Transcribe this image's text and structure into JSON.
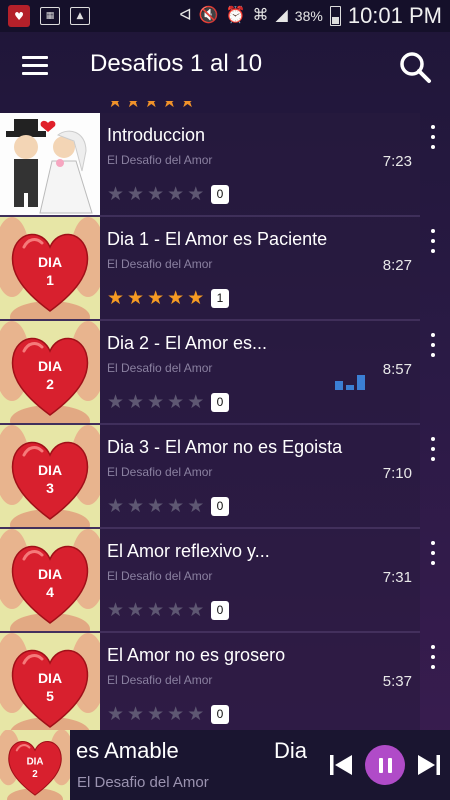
{
  "status_bar": {
    "time": "10:01 PM",
    "battery": "38%",
    "icons": [
      "app-notification-icon",
      "sim-icon",
      "image-icon",
      "bluetooth-icon",
      "mute-icon",
      "alarm-icon",
      "wifi-icon",
      "signal-icon",
      "battery-icon"
    ]
  },
  "header": {
    "title": "Desafios 1 al 10",
    "menu_icon": "hamburger-menu-icon",
    "search_icon": "search-icon"
  },
  "colors": {
    "accent": "#b04bc8",
    "star_on": "#f59a23",
    "star_off": "#5e5772",
    "heart": "#d8202e",
    "eq": "#3b7fd4"
  },
  "tracks": [
    {
      "title": "Introduccion",
      "subtitle": "El Desafio del Amor",
      "duration": "7:23",
      "rating": 0,
      "count": "0",
      "thumb": "wedding-couple",
      "thumb_label": ""
    },
    {
      "title": "Dia 1 - El Amor es Paciente",
      "subtitle": "El Desafio del Amor",
      "duration": "8:27",
      "rating": 5,
      "count": "1",
      "thumb": "heart-hands",
      "thumb_label": "DIA 1"
    },
    {
      "title": "Dia 2 - El Amor es...",
      "subtitle": "El Desafio del Amor",
      "duration": "8:57",
      "rating": 0,
      "count": "0",
      "thumb": "heart-hands",
      "thumb_label": "DIA 2",
      "playing": true
    },
    {
      "title": "Dia 3 - El Amor no es Egoista",
      "subtitle": "El Desafio del Amor",
      "duration": "7:10",
      "rating": 0,
      "count": "0",
      "thumb": "heart-hands",
      "thumb_label": "DIA 3"
    },
    {
      "title": "El Amor reflexivo y...",
      "subtitle": "El Desafio del Amor",
      "duration": "7:31",
      "rating": 0,
      "count": "0",
      "thumb": "heart-hands",
      "thumb_label": "DIA 4"
    },
    {
      "title": "El Amor no es grosero",
      "subtitle": "El Desafio del Amor",
      "duration": "5:37",
      "rating": 0,
      "count": "0",
      "thumb": "heart-hands",
      "thumb_label": "DIA 5"
    }
  ],
  "player": {
    "title_part1": "es Amable",
    "title_part2": "Dia",
    "subtitle": "El Desafio del Amor",
    "thumb_label": "DIA 2",
    "prev_icon": "skip-previous-icon",
    "pause_icon": "pause-icon",
    "next_icon": "skip-next-icon"
  }
}
